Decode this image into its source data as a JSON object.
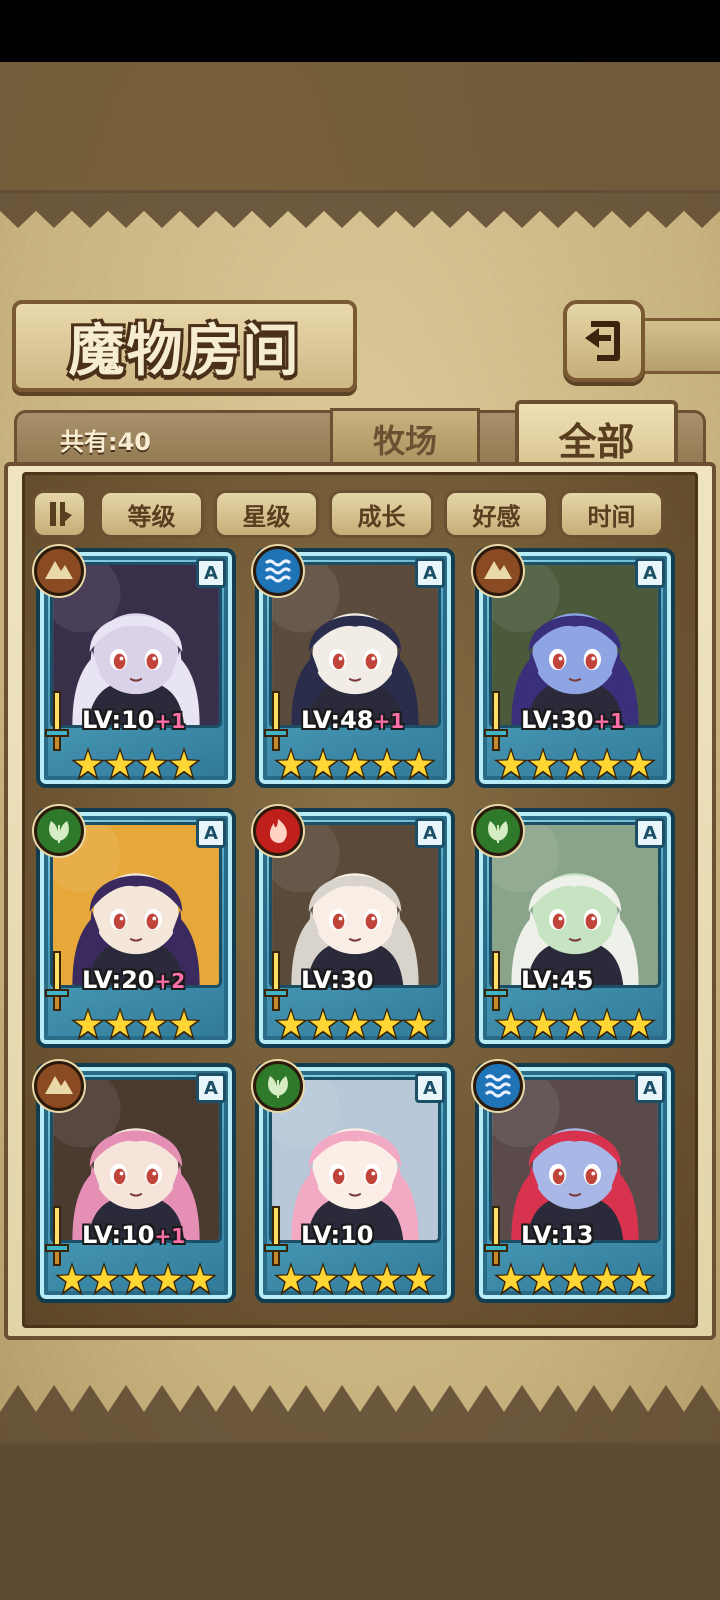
{
  "header": {
    "title": "魔物房间"
  },
  "tabs": {
    "count_label": "共有:40",
    "ranch": "牧场",
    "all": "全部"
  },
  "sort": {
    "buttons": [
      "等级",
      "星级",
      "成长",
      "好感",
      "时间"
    ]
  },
  "colors": {
    "earth": "#8a4a22",
    "water": "#1f74b8",
    "nature": "#2f7a2a",
    "fire": "#c0201c",
    "card_blue": "#4c9fbd",
    "star": "#ffd633"
  },
  "monsters": [
    {
      "element": "earth-icon",
      "rank": "A",
      "level": "LV:10",
      "bonus": "+1",
      "stars": 4,
      "hair": "#e9e4f3",
      "skin": "#d9d2e8",
      "bg": "#3a2f4a"
    },
    {
      "element": "water-icon",
      "rank": "A",
      "level": "LV:48",
      "bonus": "+1",
      "stars": 5,
      "hair": "#2b2d4d",
      "skin": "#f2ece7",
      "bg": "#5b4b3c"
    },
    {
      "element": "earth-icon",
      "rank": "A",
      "level": "LV:30",
      "bonus": "+1",
      "stars": 5,
      "hair": "#3a2f7a",
      "skin": "#8ea4e3",
      "bg": "#4a5a3a"
    },
    {
      "element": "nature-icon",
      "rank": "A",
      "level": "LV:20",
      "bonus": "+2",
      "stars": 4,
      "hair": "#3a2a5e",
      "skin": "#f4e7d9",
      "bg": "#e7a83a"
    },
    {
      "element": "fire-icon",
      "rank": "A",
      "level": "LV:30",
      "bonus": "",
      "stars": 5,
      "hair": "#d8d4cc",
      "skin": "#f8eee6",
      "bg": "#5a4a3a"
    },
    {
      "element": "nature-icon",
      "rank": "A",
      "level": "LV:45",
      "bonus": "",
      "stars": 5,
      "hair": "#eef0ea",
      "skin": "#c6e4c2",
      "bg": "#8aa48a"
    },
    {
      "element": "earth-icon",
      "rank": "A",
      "level": "LV:10",
      "bonus": "+1",
      "stars": 5,
      "hair": "#e58fb5",
      "skin": "#f6e3d9",
      "bg": "#4a3a30"
    },
    {
      "element": "nature-icon",
      "rank": "A",
      "level": "LV:10",
      "bonus": "",
      "stars": 5,
      "hair": "#f2a9c4",
      "skin": "#fbeee6",
      "bg": "#b8c8d8"
    },
    {
      "element": "water-icon",
      "rank": "A",
      "level": "LV:13",
      "bonus": "",
      "stars": 5,
      "hair": "#d8334e",
      "skin": "#a9b7e6",
      "bg": "#5a4a4a"
    }
  ]
}
